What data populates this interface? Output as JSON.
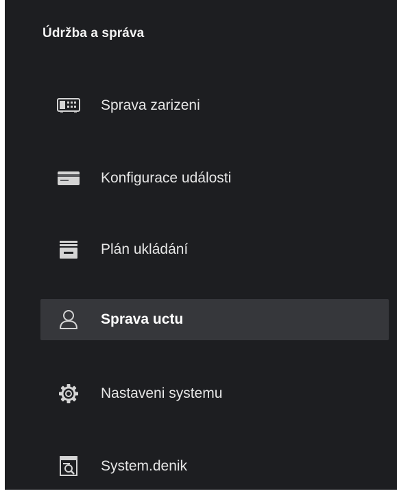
{
  "panel": {
    "title": "Údržba a správa",
    "active_index": 3,
    "items": [
      {
        "label": "Sprava zarizeni",
        "icon": "device-icon"
      },
      {
        "label": "Konfigurace události",
        "icon": "event-card-icon"
      },
      {
        "label": "Plán ukládání",
        "icon": "storage-icon"
      },
      {
        "label": "Sprava uctu",
        "icon": "user-icon"
      },
      {
        "label": "Nastaveni systemu",
        "icon": "gear-icon"
      },
      {
        "label": "System.denik",
        "icon": "log-icon"
      }
    ]
  },
  "colors": {
    "panel_background": "#1d1e21",
    "active_background": "#36373b",
    "text": "#e6e6e6",
    "icon": "#d4d4d4"
  }
}
